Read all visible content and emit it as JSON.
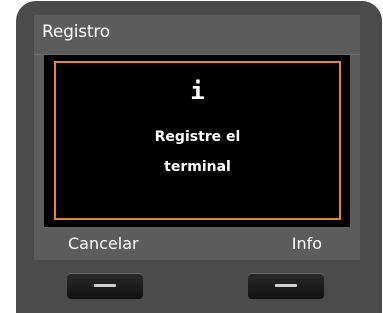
{
  "header": {
    "title": "Registro"
  },
  "dialog": {
    "icon": "info-icon",
    "icon_glyph": "i",
    "message_line1": "Registre el",
    "message_line2": "terminal",
    "border_color": "#e2853f"
  },
  "softkeys": {
    "left_label": "Cancelar",
    "right_label": "Info"
  },
  "colors": {
    "bezel": "#4b4b4b",
    "screen_bar": "#5c5c5c",
    "content_bg": "#000000"
  }
}
